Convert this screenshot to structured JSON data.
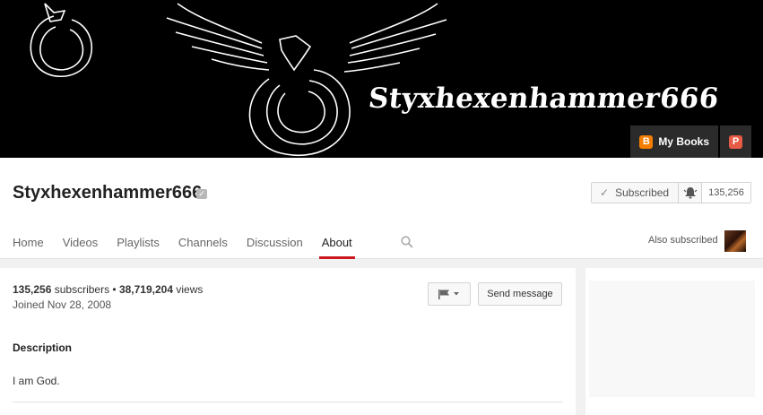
{
  "banner": {
    "title": "Styxhexenhammer666",
    "links": [
      {
        "label": "My Books",
        "icon": "blogger-icon"
      },
      {
        "label": "",
        "icon": "patreon-icon"
      }
    ]
  },
  "channel": {
    "name": "Styxhexenhammer666",
    "verified_icon": "verified-icon"
  },
  "subscribe": {
    "label": "Subscribed",
    "count": "135,256"
  },
  "tabs": [
    {
      "label": "Home"
    },
    {
      "label": "Videos"
    },
    {
      "label": "Playlists"
    },
    {
      "label": "Channels"
    },
    {
      "label": "Discussion"
    },
    {
      "label": "About",
      "active": true
    }
  ],
  "also_subscribed": "Also subscribed",
  "about": {
    "subscribers": "135,256",
    "subscribers_suffix": " subscribers • ",
    "views": "38,719,204",
    "views_suffix": " views",
    "joined": "Joined Nov 28, 2008",
    "send_message": "Send message",
    "description_title": "Description",
    "description": "I am God."
  },
  "colors": {
    "accent": "#cc181e",
    "blogger": "#f57d00",
    "patreon": "#e85b46"
  }
}
